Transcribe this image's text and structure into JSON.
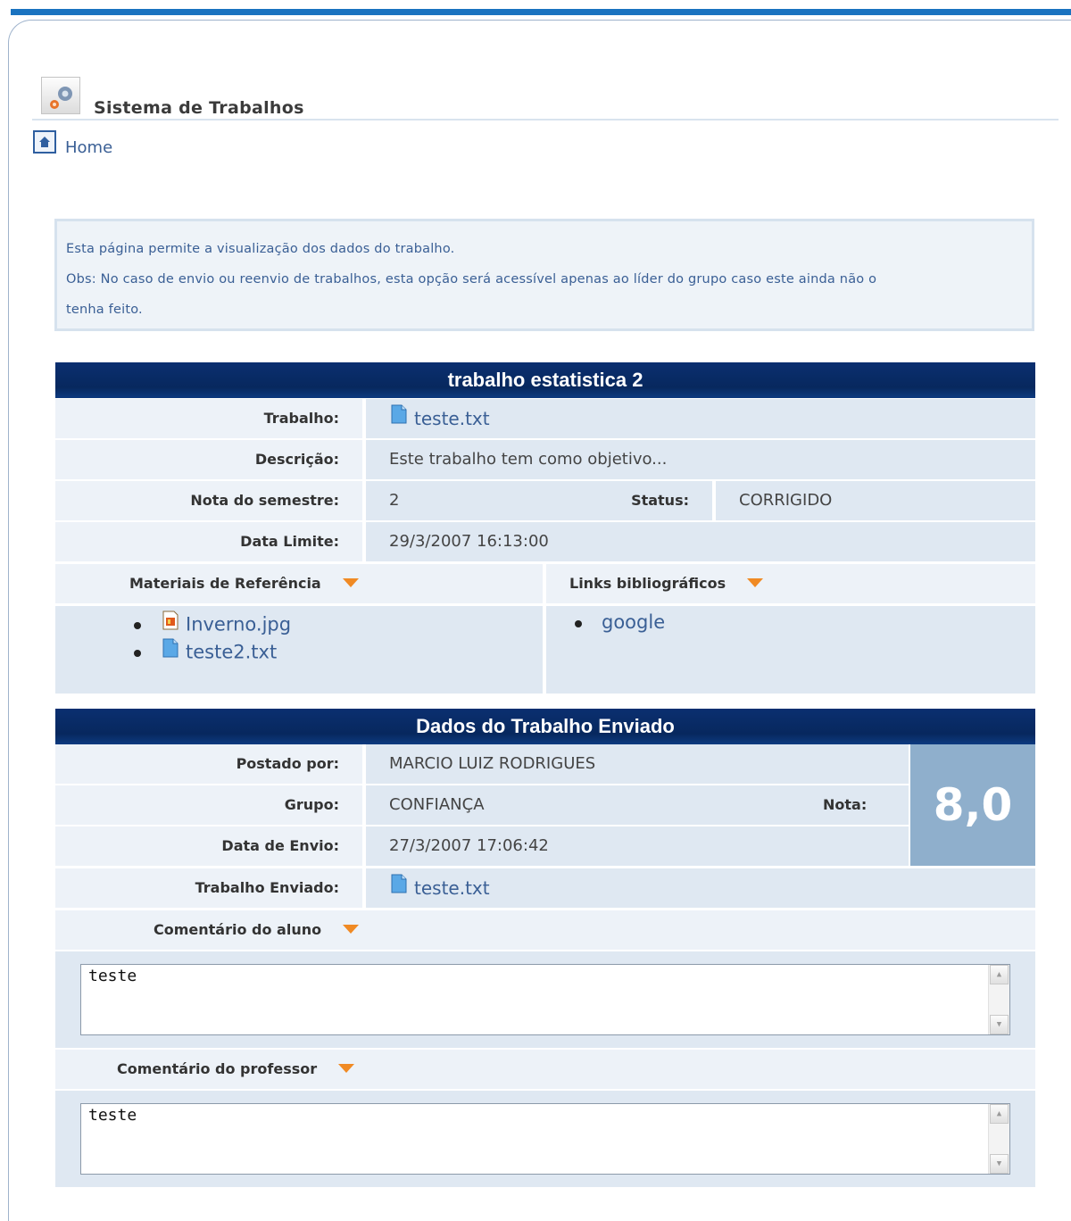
{
  "app": {
    "title": "Sistema de Trabalhos",
    "icon": "gear-icon"
  },
  "nav": {
    "home_label": "Home",
    "home_icon": "home-icon"
  },
  "info": {
    "line1": "Esta página permite a visualização dos dados do trabalho.",
    "line2": "Obs: No caso de envio ou reenvio de trabalhos, esta opção será acessível apenas ao líder do grupo caso este ainda não o",
    "line3": "tenha feito."
  },
  "assignment": {
    "header": "trabalho estatistica 2",
    "trabalho_label": "Trabalho:",
    "trabalho_file": "teste.txt",
    "descricao_label": "Descrição:",
    "descricao_value": "Este trabalho tem como objetivo...",
    "nota_semestre_label": "Nota do semestre:",
    "nota_semestre_value": "2",
    "status_label": "Status:",
    "status_value": "CORRIGIDO",
    "data_limite_label": "Data Limite:",
    "data_limite_value": "29/3/2007 16:13:00",
    "materiais_label": "Materiais de Referência",
    "materiais": [
      "Inverno.jpg",
      "teste2.txt"
    ],
    "links_label": "Links bibliográficos",
    "links": [
      "google"
    ]
  },
  "submission": {
    "header": "Dados do Trabalho Enviado",
    "postado_label": "Postado por:",
    "postado_value": "MARCIO LUIZ RODRIGUES",
    "grupo_label": "Grupo:",
    "grupo_value": "CONFIANÇA",
    "nota_label": "Nota:",
    "nota_value": "8,0",
    "data_envio_label": "Data de Envio:",
    "data_envio_value": "27/3/2007 17:06:42",
    "enviado_label": "Trabalho Enviado:",
    "enviado_file": "teste.txt",
    "comentario_aluno_label": "Comentário do aluno",
    "comentario_aluno_value": "teste",
    "comentario_prof_label": "Comentário do professor",
    "comentario_prof_value": "teste"
  },
  "colors": {
    "header_navy": "#07285e",
    "accent_orange": "#f08a24",
    "grade_box": "#8fafcc",
    "link": "#3a5f95"
  }
}
